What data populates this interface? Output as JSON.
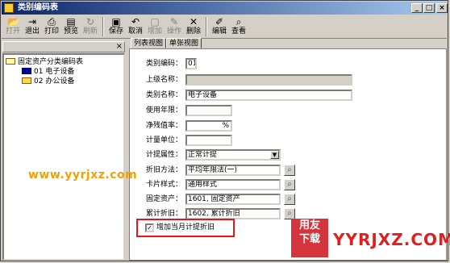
{
  "window": {
    "title": "类别编码表",
    "controls": [
      "_",
      "□",
      "×"
    ]
  },
  "toolbar": [
    {
      "label": "打开",
      "icon": "open-icon",
      "disabled": true
    },
    {
      "label": "退出",
      "icon": "exit-icon",
      "disabled": false
    },
    {
      "label": "打印",
      "icon": "print-icon",
      "disabled": false
    },
    {
      "label": "预览",
      "icon": "preview-icon",
      "disabled": false
    },
    {
      "label": "刷新",
      "icon": "refresh-icon",
      "disabled": true
    },
    {
      "label": "保存",
      "icon": "save-icon",
      "disabled": false
    },
    {
      "label": "取消",
      "icon": "cancel-icon",
      "disabled": false
    },
    {
      "label": "增加",
      "icon": "add-icon",
      "disabled": true
    },
    {
      "label": "操作",
      "icon": "operate-icon",
      "disabled": true
    },
    {
      "label": "删除",
      "icon": "delete-icon",
      "disabled": false
    },
    {
      "label": "编辑",
      "icon": "edit-icon",
      "disabled": false
    },
    {
      "label": "查看",
      "icon": "view-icon",
      "disabled": false
    }
  ],
  "tree": {
    "close": "×",
    "root": "固定资产分类编码表",
    "items": [
      {
        "label": "01 电子设备",
        "selected": true
      },
      {
        "label": "02 办公设备",
        "selected": false
      }
    ]
  },
  "tabs": [
    {
      "label": "列表视图",
      "active": false
    },
    {
      "label": "单张视图",
      "active": true
    }
  ],
  "form": {
    "code": {
      "label": "类别编码：",
      "value": "01"
    },
    "parent_name": {
      "label": "上级名称：",
      "value": ""
    },
    "name": {
      "label": "类别名称：",
      "value": "电子设备"
    },
    "life": {
      "label": "使用年限：",
      "value": ""
    },
    "residual": {
      "label": "净残值率：",
      "value": "",
      "suffix": "%"
    },
    "unit": {
      "label": "计量单位：",
      "value": ""
    },
    "accrual": {
      "label": "计提属性：",
      "value": "正常计提"
    },
    "method": {
      "label": "折旧方法：",
      "value": "平均年限法(一)"
    },
    "card_style": {
      "label": "卡片样式：",
      "value": "通用样式"
    },
    "fixed_asset": {
      "label": "固定资产：",
      "value": "1601, 固定资产"
    },
    "accum_dep": {
      "label": "累计折旧：",
      "value": "1602, 累计折旧"
    },
    "checkbox": {
      "label": "增加当月计提折旧",
      "checked": true,
      "mark": "✓"
    }
  },
  "watermarks": {
    "left_text": "www.yyrjxz.com",
    "logo_line1": "用友",
    "logo_line2": "下载",
    "right_text": "YYRJXZ.COM"
  },
  "colors": {
    "title_bar": "#0a246a",
    "highlight_border": "#e8141c",
    "watermark_orange": "#f3a000",
    "watermark_red": "#e02020"
  }
}
